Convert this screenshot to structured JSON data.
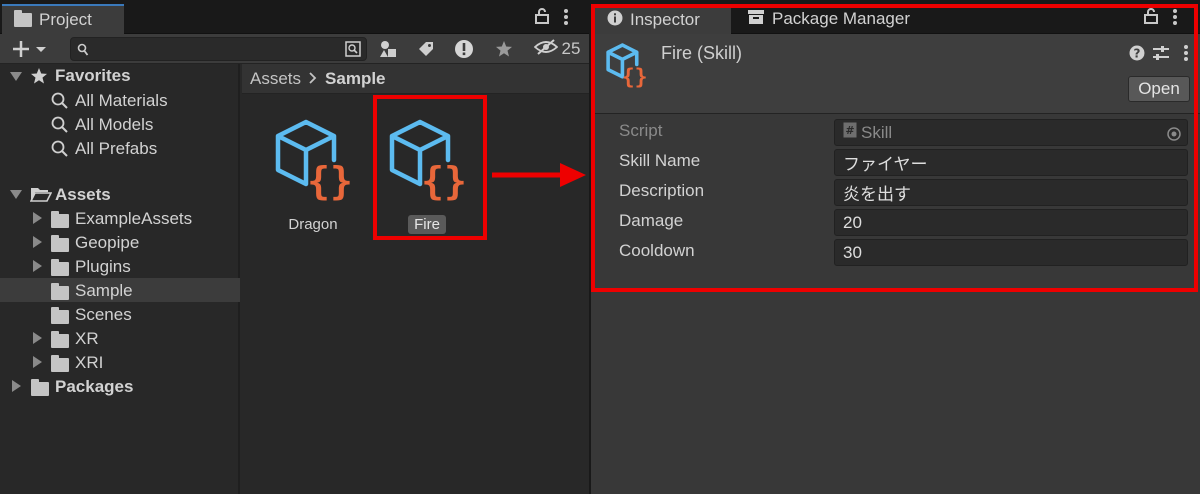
{
  "project": {
    "tab_label": "Project",
    "hidden_count": "25",
    "search": {
      "value": ""
    },
    "favorites": {
      "label": "Favorites",
      "items": [
        "All Materials",
        "All Models",
        "All Prefabs"
      ]
    },
    "assets": {
      "label": "Assets",
      "folders": [
        "ExampleAssets",
        "Geopipe",
        "Plugins",
        "Sample",
        "Scenes",
        "XR",
        "XRI"
      ]
    },
    "packages_label": "Packages",
    "breadcrumb": {
      "root": "Assets",
      "current": "Sample"
    },
    "tiles": [
      {
        "label": "Dragon"
      },
      {
        "label": "Fire"
      }
    ]
  },
  "inspector": {
    "tab_label": "Inspector",
    "tab2_label": "Package Manager",
    "title": "Fire (Skill)",
    "open_button": "Open",
    "fields": [
      {
        "label": "Script",
        "value": "Skill"
      },
      {
        "label": "Skill Name",
        "value": "ファイヤー"
      },
      {
        "label": "Description",
        "value": "炎を出す"
      },
      {
        "label": "Damage",
        "value": "20"
      },
      {
        "label": "Cooldown",
        "value": "30"
      }
    ]
  },
  "colors": {
    "cube_blue": "#5cbbf0",
    "brace_orange": "#e8673a",
    "highlight_red": "#ee0000"
  }
}
